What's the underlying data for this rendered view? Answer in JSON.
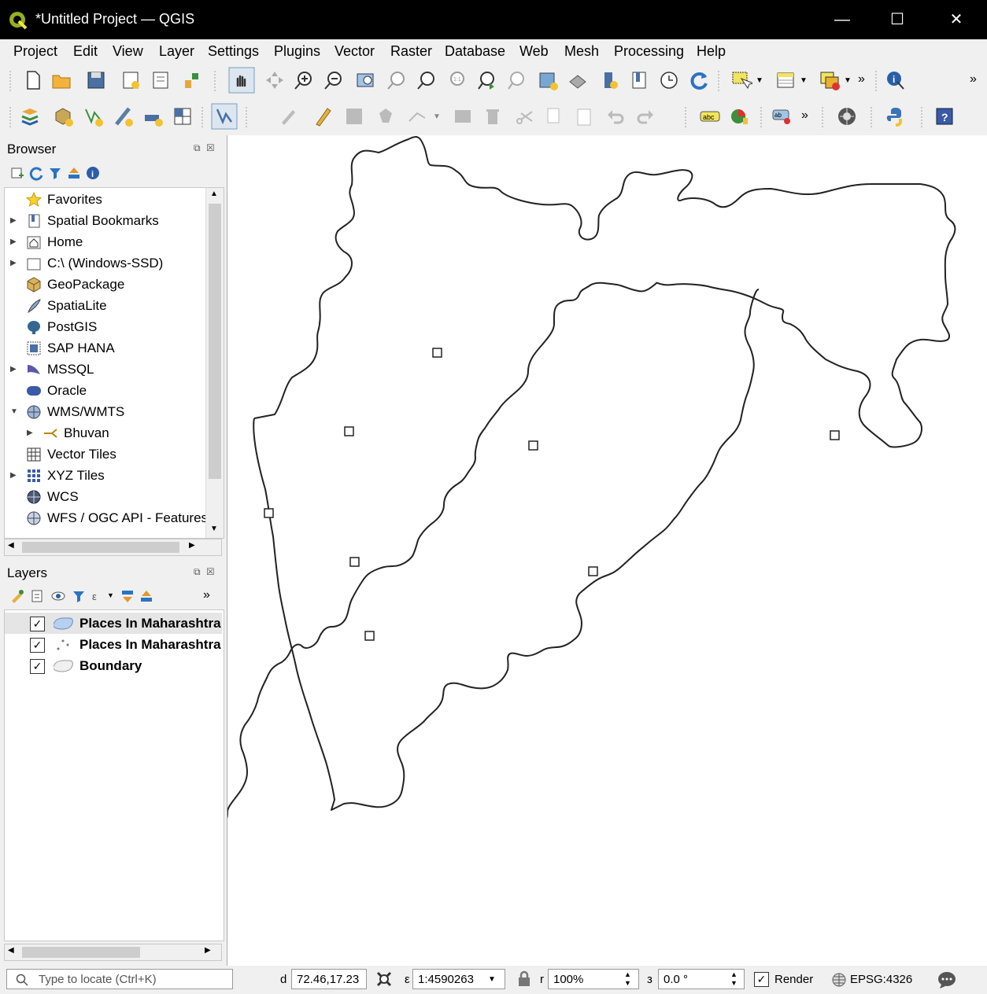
{
  "window": {
    "title": "*Untitled Project — QGIS",
    "minimize": "—",
    "maximize": "☐",
    "close": "✕"
  },
  "menu": [
    "Project",
    "Edit",
    "View",
    "Layer",
    "Settings",
    "Plugins",
    "Vector",
    "Raster",
    "Database",
    "Web",
    "Mesh",
    "Processing",
    "Help"
  ],
  "browser": {
    "title": "Browser",
    "items": [
      {
        "label": "Favorites",
        "icon": "star-icon",
        "expandable": false
      },
      {
        "label": "Spatial Bookmarks",
        "icon": "bookmark-icon",
        "expandable": true
      },
      {
        "label": "Home",
        "icon": "home-folder-icon",
        "expandable": true
      },
      {
        "label": "C:\\ (Windows-SSD)",
        "icon": "drive-folder-icon",
        "expandable": true
      },
      {
        "label": "GeoPackage",
        "icon": "geopackage-icon",
        "expandable": false
      },
      {
        "label": "SpatiaLite",
        "icon": "spatialite-icon",
        "expandable": false
      },
      {
        "label": "PostGIS",
        "icon": "postgis-icon",
        "expandable": false
      },
      {
        "label": "SAP HANA",
        "icon": "sap-hana-icon",
        "expandable": false
      },
      {
        "label": "MSSQL",
        "icon": "mssql-icon",
        "expandable": true
      },
      {
        "label": "Oracle",
        "icon": "oracle-icon",
        "expandable": false
      },
      {
        "label": "WMS/WMTS",
        "icon": "wms-globe-icon",
        "expandable": true,
        "expanded": true
      },
      {
        "label": "Bhuvan",
        "icon": "wms-connection-icon",
        "expandable": true,
        "indent": 1
      },
      {
        "label": "Vector Tiles",
        "icon": "vector-tiles-icon",
        "expandable": false
      },
      {
        "label": "XYZ Tiles",
        "icon": "xyz-tiles-icon",
        "expandable": true
      },
      {
        "label": "WCS",
        "icon": "wcs-globe-icon",
        "expandable": false
      },
      {
        "label": "WFS / OGC API - Features",
        "icon": "wfs-globe-icon",
        "expandable": false
      }
    ]
  },
  "layers": {
    "title": "Layers",
    "items": [
      {
        "label": "Places In Maharashtra",
        "checked": "✓",
        "icon": "polygon-layer-icon",
        "selected": true
      },
      {
        "label": "Places In Maharashtra",
        "checked": "✓",
        "icon": "point-layer-icon",
        "selected": false
      },
      {
        "label": "Boundary",
        "checked": "✓",
        "icon": "polygon-layer-icon",
        "selected": false
      }
    ]
  },
  "status": {
    "locator_placeholder": "Type to locate (Ctrl+K)",
    "coord_label": "d",
    "coordinate": "72.46,17.23",
    "scale_label": "ε",
    "scale": "1:4590263",
    "magnifier_label": "r",
    "magnifier": "100%",
    "rotation_label": "з",
    "rotation": "0.0 °",
    "render_checked": "✓",
    "render_label": "Render",
    "crs": "EPSG:4326"
  },
  "colors": {
    "accent": "#3c8f3c",
    "map_bg": "#ffffff",
    "titlebar": "#000000"
  }
}
